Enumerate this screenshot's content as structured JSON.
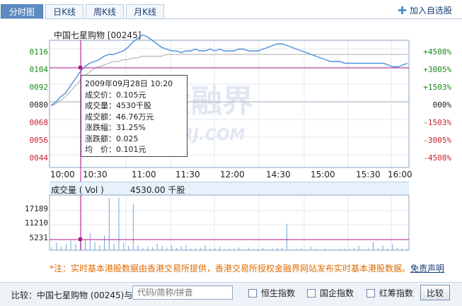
{
  "tabs": [
    {
      "label": "分时图",
      "active": true
    },
    {
      "label": "日K线",
      "active": false
    },
    {
      "label": "周K线",
      "active": false
    },
    {
      "label": "月K线",
      "active": false
    }
  ],
  "add_favorite_label": "加入自选股",
  "stock": {
    "name": "中国七星购物",
    "code": "[00245]"
  },
  "price_axis": [
    "0116",
    "0104",
    "0092",
    "0080",
    "0068",
    "0056",
    "0044"
  ],
  "pct_axis": [
    "+4508%",
    "+3005%",
    "+1503%",
    "000%",
    "-1503%",
    "-3005%",
    "-4508%"
  ],
  "time_axis": [
    "10:00",
    "10:30",
    "11:00",
    "11:30",
    "12:00",
    "14:30",
    "15:00",
    "15:30",
    "16:00"
  ],
  "tooltip": {
    "datetime": "2009年09月28日 10:20",
    "price": "成交价：0.105元",
    "volume": "成交量：4530千股",
    "amount": "成交额：46.76万元",
    "change_pct": "涨跌幅：31.25%",
    "change_amt": "涨跌额：0.025",
    "avg": "均　价：0.101元"
  },
  "volume": {
    "label": "成交量 ( Vol )",
    "value": "4530.00 千股",
    "axis": [
      "17189",
      "11210",
      "5231"
    ]
  },
  "watermark": {
    "main": "金融界",
    "sub": "JRJ.COM"
  },
  "note": {
    "text": "*注：实时基本港股数据由香港交易所提供，香港交易所授权金融界网站发布实时基本港股数据。",
    "link": "免责声明"
  },
  "compare": {
    "label": "比较：中国七星购物 (00245)与",
    "input_placeholder": "代码/简称/拼音",
    "options": [
      "恒生指数",
      "国企指数",
      "红筹指数"
    ],
    "button": "比较"
  },
  "colors": {
    "price_line": "#4a90d9",
    "avg_line": "#aaaaaa",
    "cursor": "#b0148a",
    "up": "#c8202c",
    "down": "#1a8a1a"
  },
  "chart_data": {
    "type": "line",
    "x_range": [
      "10:00",
      "16:00"
    ],
    "ylim": [
      0.044,
      0.116
    ],
    "y_ref": 0.08,
    "series": [],
    "price": [
      0.079,
      0.081,
      0.084,
      0.086,
      0.09,
      0.094,
      0.098,
      0.101,
      0.103,
      0.104,
      0.105,
      0.107,
      0.108,
      0.108,
      0.109,
      0.11,
      0.112,
      0.115,
      0.117,
      0.119,
      0.118,
      0.116,
      0.114,
      0.112,
      0.111,
      0.11,
      0.11,
      0.109,
      0.11,
      0.11,
      0.111,
      0.11,
      0.11,
      0.111,
      0.11,
      0.111,
      0.11,
      0.11,
      0.11,
      0.111,
      0.111,
      0.11,
      0.11,
      0.11,
      0.111,
      0.112,
      0.113,
      0.114,
      0.114,
      0.113,
      0.112,
      0.111,
      0.11,
      0.109,
      0.108,
      0.107,
      0.106,
      0.105,
      0.104,
      0.104,
      0.104,
      0.103,
      0.103,
      0.103,
      0.103,
      0.103,
      0.103,
      0.103,
      0.103,
      0.103,
      0.102,
      0.101,
      0.101,
      0.102,
      0.103
    ],
    "avg": [
      0.079,
      0.08,
      0.082,
      0.084,
      0.087,
      0.09,
      0.093,
      0.096,
      0.098,
      0.1,
      0.101,
      0.102,
      0.103,
      0.104,
      0.104,
      0.105,
      0.105,
      0.106,
      0.106,
      0.107,
      0.107,
      0.107,
      0.107,
      0.107,
      0.108,
      0.108,
      0.108,
      0.108,
      0.108,
      0.108,
      0.108,
      0.108,
      0.108,
      0.108,
      0.108,
      0.108,
      0.108,
      0.108,
      0.108,
      0.108,
      0.108,
      0.108,
      0.108,
      0.108,
      0.108,
      0.108,
      0.108,
      0.108,
      0.108,
      0.108,
      0.108,
      0.108,
      0.108,
      0.108,
      0.108,
      0.108,
      0.108,
      0.108,
      0.108,
      0.108,
      0.108,
      0.108,
      0.108,
      0.108,
      0.108,
      0.108,
      0.108,
      0.108,
      0.108,
      0.108,
      0.108,
      0.108,
      0.108,
      0.108,
      0.108
    ],
    "volumes": [
      1200,
      3000,
      1500,
      2500,
      4000,
      2600,
      5200,
      4530,
      7000,
      3200,
      2000,
      6000,
      21500,
      2500,
      21500,
      3000,
      1700,
      19000,
      2000,
      1000,
      1500,
      1200,
      2500,
      1800,
      1200,
      2000,
      900,
      1500,
      2200,
      600,
      800,
      1000,
      2200,
      600,
      900,
      1500,
      400,
      800,
      700,
      1200,
      300,
      1100,
      600,
      500,
      900,
      400,
      700,
      900,
      1000,
      10800,
      400,
      600,
      800,
      300,
      1400,
      600,
      200,
      700,
      400,
      300,
      500,
      700,
      600,
      900,
      1800,
      400,
      700,
      3200,
      800,
      2000,
      700,
      2300,
      900,
      700,
      600
    ],
    "volume_axis": [
      5231,
      11210,
      17189
    ]
  }
}
